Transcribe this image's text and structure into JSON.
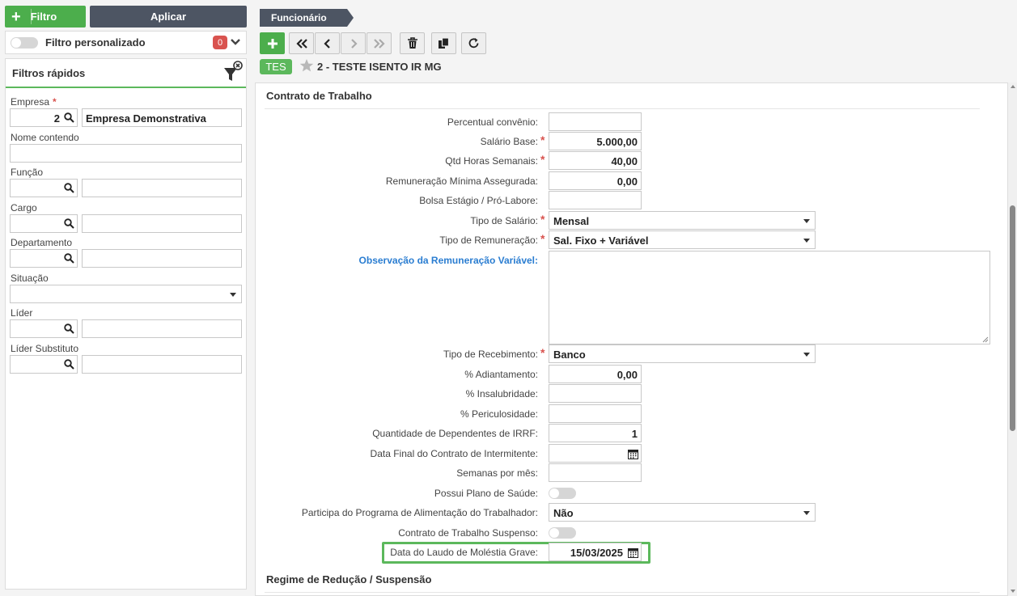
{
  "left": {
    "filtro_label": "Filtro",
    "aplicar_label": "Aplicar",
    "filtro_personalizado": "Filtro personalizado",
    "badge_count": "0",
    "quick_title": "Filtros rápidos",
    "fields": {
      "empresa": {
        "label": "Empresa",
        "code": "2",
        "name": "Empresa Demonstrativa"
      },
      "nome": {
        "label": "Nome contendo"
      },
      "funcao": {
        "label": "Função"
      },
      "cargo": {
        "label": "Cargo"
      },
      "departamento": {
        "label": "Departamento"
      },
      "situacao": {
        "label": "Situação"
      },
      "lider": {
        "label": "Líder"
      },
      "lider_substituto": {
        "label": "Líder Substituto"
      }
    }
  },
  "header": {
    "tab": "Funcionário",
    "tag": "TES",
    "record": "2 - TESTE ISENTO IR MG"
  },
  "form": {
    "section1": "Contrato de Trabalho",
    "section2": "Regime de Redução / Suspensão",
    "percentual_convenio": {
      "label": "Percentual convênio:",
      "value": ""
    },
    "salario_base": {
      "label": "Salário Base:",
      "value": "5.000,00"
    },
    "qtd_horas": {
      "label": "Qtd Horas Semanais:",
      "value": "40,00"
    },
    "remuneracao_minima": {
      "label": "Remuneração Mínima Assegurada:",
      "value": "0,00"
    },
    "bolsa_estagio": {
      "label": "Bolsa Estágio / Pró-Labore:",
      "value": ""
    },
    "tipo_salario": {
      "label": "Tipo de Salário:",
      "value": "Mensal"
    },
    "tipo_remuneracao": {
      "label": "Tipo de Remuneração:",
      "value": "Sal. Fixo + Variável"
    },
    "observacao": {
      "label": "Observação da Remuneração Variável:",
      "value": ""
    },
    "tipo_recebimento": {
      "label": "Tipo de Recebimento:",
      "value": "Banco"
    },
    "adiantamento": {
      "label": "% Adiantamento:",
      "value": "0,00"
    },
    "insalubridade": {
      "label": "% Insalubridade:",
      "value": ""
    },
    "periculosidade": {
      "label": "% Periculosidade:",
      "value": ""
    },
    "dependentes": {
      "label": "Quantidade de Dependentes de IRRF:",
      "value": "1"
    },
    "data_final": {
      "label": "Data Final do Contrato de Intermitente:",
      "value": ""
    },
    "semanas": {
      "label": "Semanas por mês:",
      "value": ""
    },
    "plano_saude": {
      "label": "Possui Plano de Saúde:"
    },
    "pat": {
      "label": "Participa do Programa de Alimentação do Trabalhador:",
      "value": "Não"
    },
    "suspenso": {
      "label": "Contrato de Trabalho Suspenso:"
    },
    "data_laudo": {
      "label": "Data do Laudo de Moléstia Grave:",
      "value": "15/03/2025"
    }
  },
  "colors": {
    "green": "#4cae4c",
    "dark": "#4d5563",
    "red": "#d9534f",
    "link": "#2a7dd1"
  }
}
